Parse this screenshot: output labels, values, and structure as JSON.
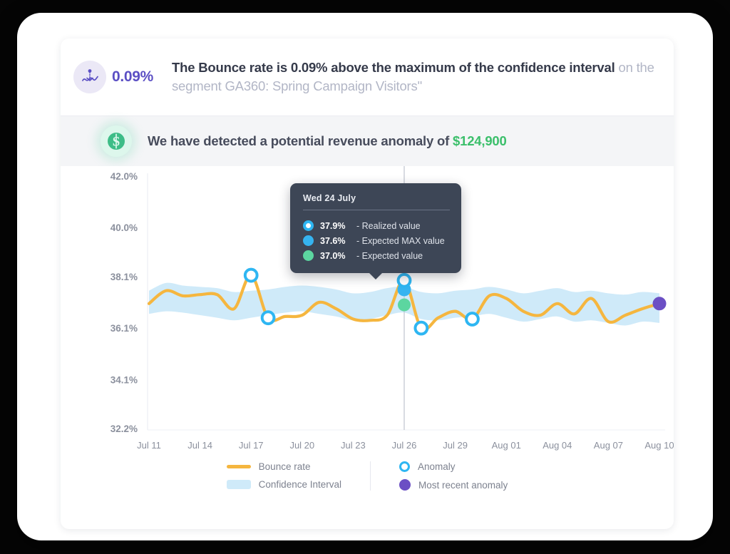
{
  "header": {
    "icon": "anomaly-wave-icon",
    "kpi_value": "0.09%",
    "headline_bold": "The Bounce rate is 0.09% above the maximum of the confidence interval",
    "headline_muted": " on the segment GA360: Spring Campaign Visitors\"",
    "accent_color": "#5b4fc4"
  },
  "revenue_banner": {
    "icon": "dollar-sign-icon",
    "text_prefix": "We have detected a potential revenue anomaly of ",
    "amount": "$124,900",
    "amount_color": "#3bbf6b"
  },
  "tooltip": {
    "title": "Wed 24 July",
    "rows": [
      {
        "value": "37.9%",
        "label": "- Realized value",
        "marker": "ring",
        "color": "#2eb6f2"
      },
      {
        "value": "37.6%",
        "label": "- Expected MAX value",
        "marker": "solid",
        "color": "#35b4f0"
      },
      {
        "value": "37.0%",
        "label": "- Expected value",
        "marker": "solid",
        "color": "#5cd6a0"
      }
    ]
  },
  "legend": {
    "items": [
      {
        "label": "Bounce rate",
        "swatch": "line",
        "color": "#f5b63f"
      },
      {
        "label": "Confidence Interval",
        "swatch": "band",
        "color": "#cfeaf9"
      },
      {
        "label": "Anomaly",
        "swatch": "ring",
        "color": "#2eb6f2"
      },
      {
        "label": "Most recent anomaly",
        "swatch": "dot",
        "color": "#6b4fc4"
      }
    ]
  },
  "chart_data": {
    "type": "line",
    "title": "",
    "xlabel": "",
    "ylabel": "",
    "ylim": [
      32.2,
      42.0
    ],
    "grid": false,
    "legend_position": "bottom",
    "y_ticks": [
      "42.0%",
      "40.0%",
      "38.1%",
      "36.1%",
      "34.1%",
      "32.2%"
    ],
    "y_tick_values": [
      42.0,
      40.0,
      38.1,
      36.1,
      34.1,
      32.2
    ],
    "x_ticks": [
      "Jul 11",
      "Jul 14",
      "Jul 17",
      "Jul 20",
      "Jul 23",
      "Jul 26",
      "Jul 29",
      "Aug 01",
      "Aug 04",
      "Aug 07",
      "Aug 10"
    ],
    "series": [
      {
        "name": "Bounce rate",
        "color": "#f5b63f",
        "values": [
          37.05,
          37.55,
          37.35,
          37.4,
          37.4,
          36.85,
          38.15,
          36.5,
          36.55,
          36.6,
          37.1,
          36.85,
          36.45,
          36.4,
          36.6,
          37.95,
          36.1,
          36.5,
          36.75,
          36.45,
          37.35,
          37.25,
          36.75,
          36.6,
          37.05,
          36.65,
          37.25,
          36.35,
          36.6,
          36.85,
          37.05
        ]
      },
      {
        "name": "Confidence Interval upper",
        "color": "#cfeaf9",
        "values": [
          37.55,
          37.85,
          37.75,
          37.7,
          37.65,
          37.5,
          37.55,
          37.6,
          37.7,
          37.75,
          37.7,
          37.6,
          37.45,
          37.5,
          37.65,
          37.7,
          37.5,
          37.45,
          37.55,
          37.6,
          37.7,
          37.6,
          37.45,
          37.55,
          37.65,
          37.5,
          37.55,
          37.45,
          37.4,
          37.5,
          37.45
        ]
      },
      {
        "name": "Confidence Interval lower",
        "color": "#cfeaf9",
        "values": [
          36.65,
          36.75,
          36.7,
          36.6,
          36.5,
          36.4,
          36.5,
          36.6,
          36.7,
          36.75,
          36.65,
          36.55,
          36.4,
          36.45,
          36.6,
          36.7,
          36.45,
          36.4,
          36.5,
          36.55,
          36.65,
          36.5,
          36.35,
          36.45,
          36.55,
          36.35,
          36.4,
          36.3,
          36.2,
          36.35,
          36.3
        ]
      }
    ],
    "anomalies": [
      {
        "x_index": 6,
        "value": 38.15,
        "label": "Anomaly"
      },
      {
        "x_index": 7,
        "value": 36.5,
        "label": "Anomaly"
      },
      {
        "x_index": 15,
        "value": 37.95,
        "label": "Anomaly"
      },
      {
        "x_index": 16,
        "value": 36.1,
        "label": "Anomaly"
      },
      {
        "x_index": 19,
        "value": 36.45,
        "label": "Anomaly"
      }
    ],
    "most_recent_anomaly": {
      "x_index": 30,
      "value": 37.05,
      "label": "Most recent anomaly"
    },
    "hover": {
      "date": "Wed 24 July",
      "realized": 37.9,
      "expected_max": 37.6,
      "expected": 37.0
    }
  }
}
